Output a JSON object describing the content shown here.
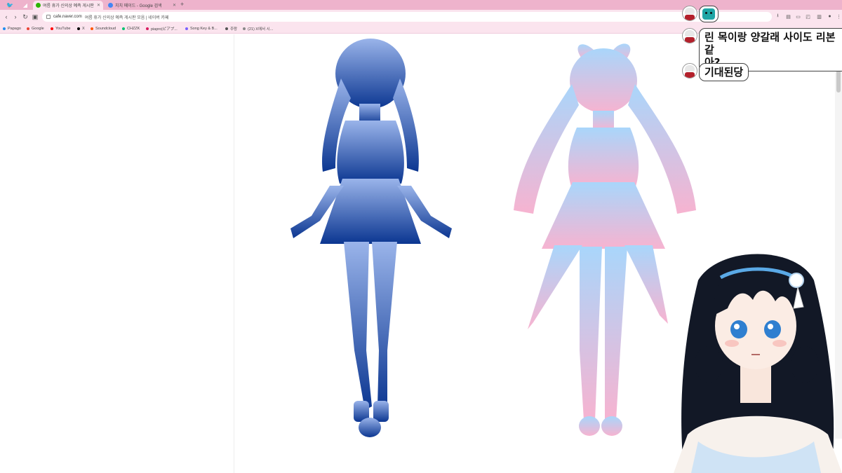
{
  "browser": {
    "tabs": [
      {
        "title": "여름 휴가 신의상 예측 게시판",
        "active": true,
        "favicon_color": "#2db400"
      },
      {
        "title": "치치 메이드 - Google 검색",
        "active": false,
        "favicon_color": "#4285f4"
      }
    ],
    "new_tab_symbol": "+",
    "omnibox": {
      "host": "cafe.naver.com",
      "path": "여름 휴가 신의상 예측 게시판 모음 | 네이버 카페"
    },
    "bookmarks": [
      {
        "label": "Papago",
        "color": "#1f8ef1"
      },
      {
        "label": "Google",
        "color": "#ea4335"
      },
      {
        "label": "YouTube",
        "color": "#ff0000"
      },
      {
        "label": "X",
        "color": "#000000"
      },
      {
        "label": "Soundcloud",
        "color": "#ff5500"
      },
      {
        "label": "CHZZK",
        "color": "#00c26f"
      },
      {
        "label": "piapro|ピアプ...",
        "color": "#d81b60"
      },
      {
        "label": "Song Key & B...",
        "color": "#7b61ff"
      },
      {
        "label": "주랑",
        "color": "#555555"
      },
      {
        "label": "(21) X에서 시...",
        "color": "#888888"
      }
    ]
  },
  "page": {
    "silhouettes": [
      {
        "name": "blue",
        "gradient": [
          "#9ab4ea",
          "#0b3691"
        ]
      },
      {
        "name": "pastel",
        "gradient": [
          "#a9d6fb",
          "#f7b3d0"
        ]
      }
    ]
  },
  "chat": [
    {
      "user_icon": "chef-avatar",
      "emote": "teal-face-emote",
      "text": ""
    },
    {
      "user_icon": "chef-avatar",
      "text_line1": "린 목이랑 양갈래 사이도 리본같",
      "text_line2": "아?"
    },
    {
      "user_icon": "chef-avatar",
      "text": "기대된당"
    }
  ],
  "colors": {
    "tab_strip": "#eeb3cc",
    "toolbar": "#fbe4ee",
    "hair": "#121826",
    "ribbon_accent": "#5aa9e6"
  }
}
